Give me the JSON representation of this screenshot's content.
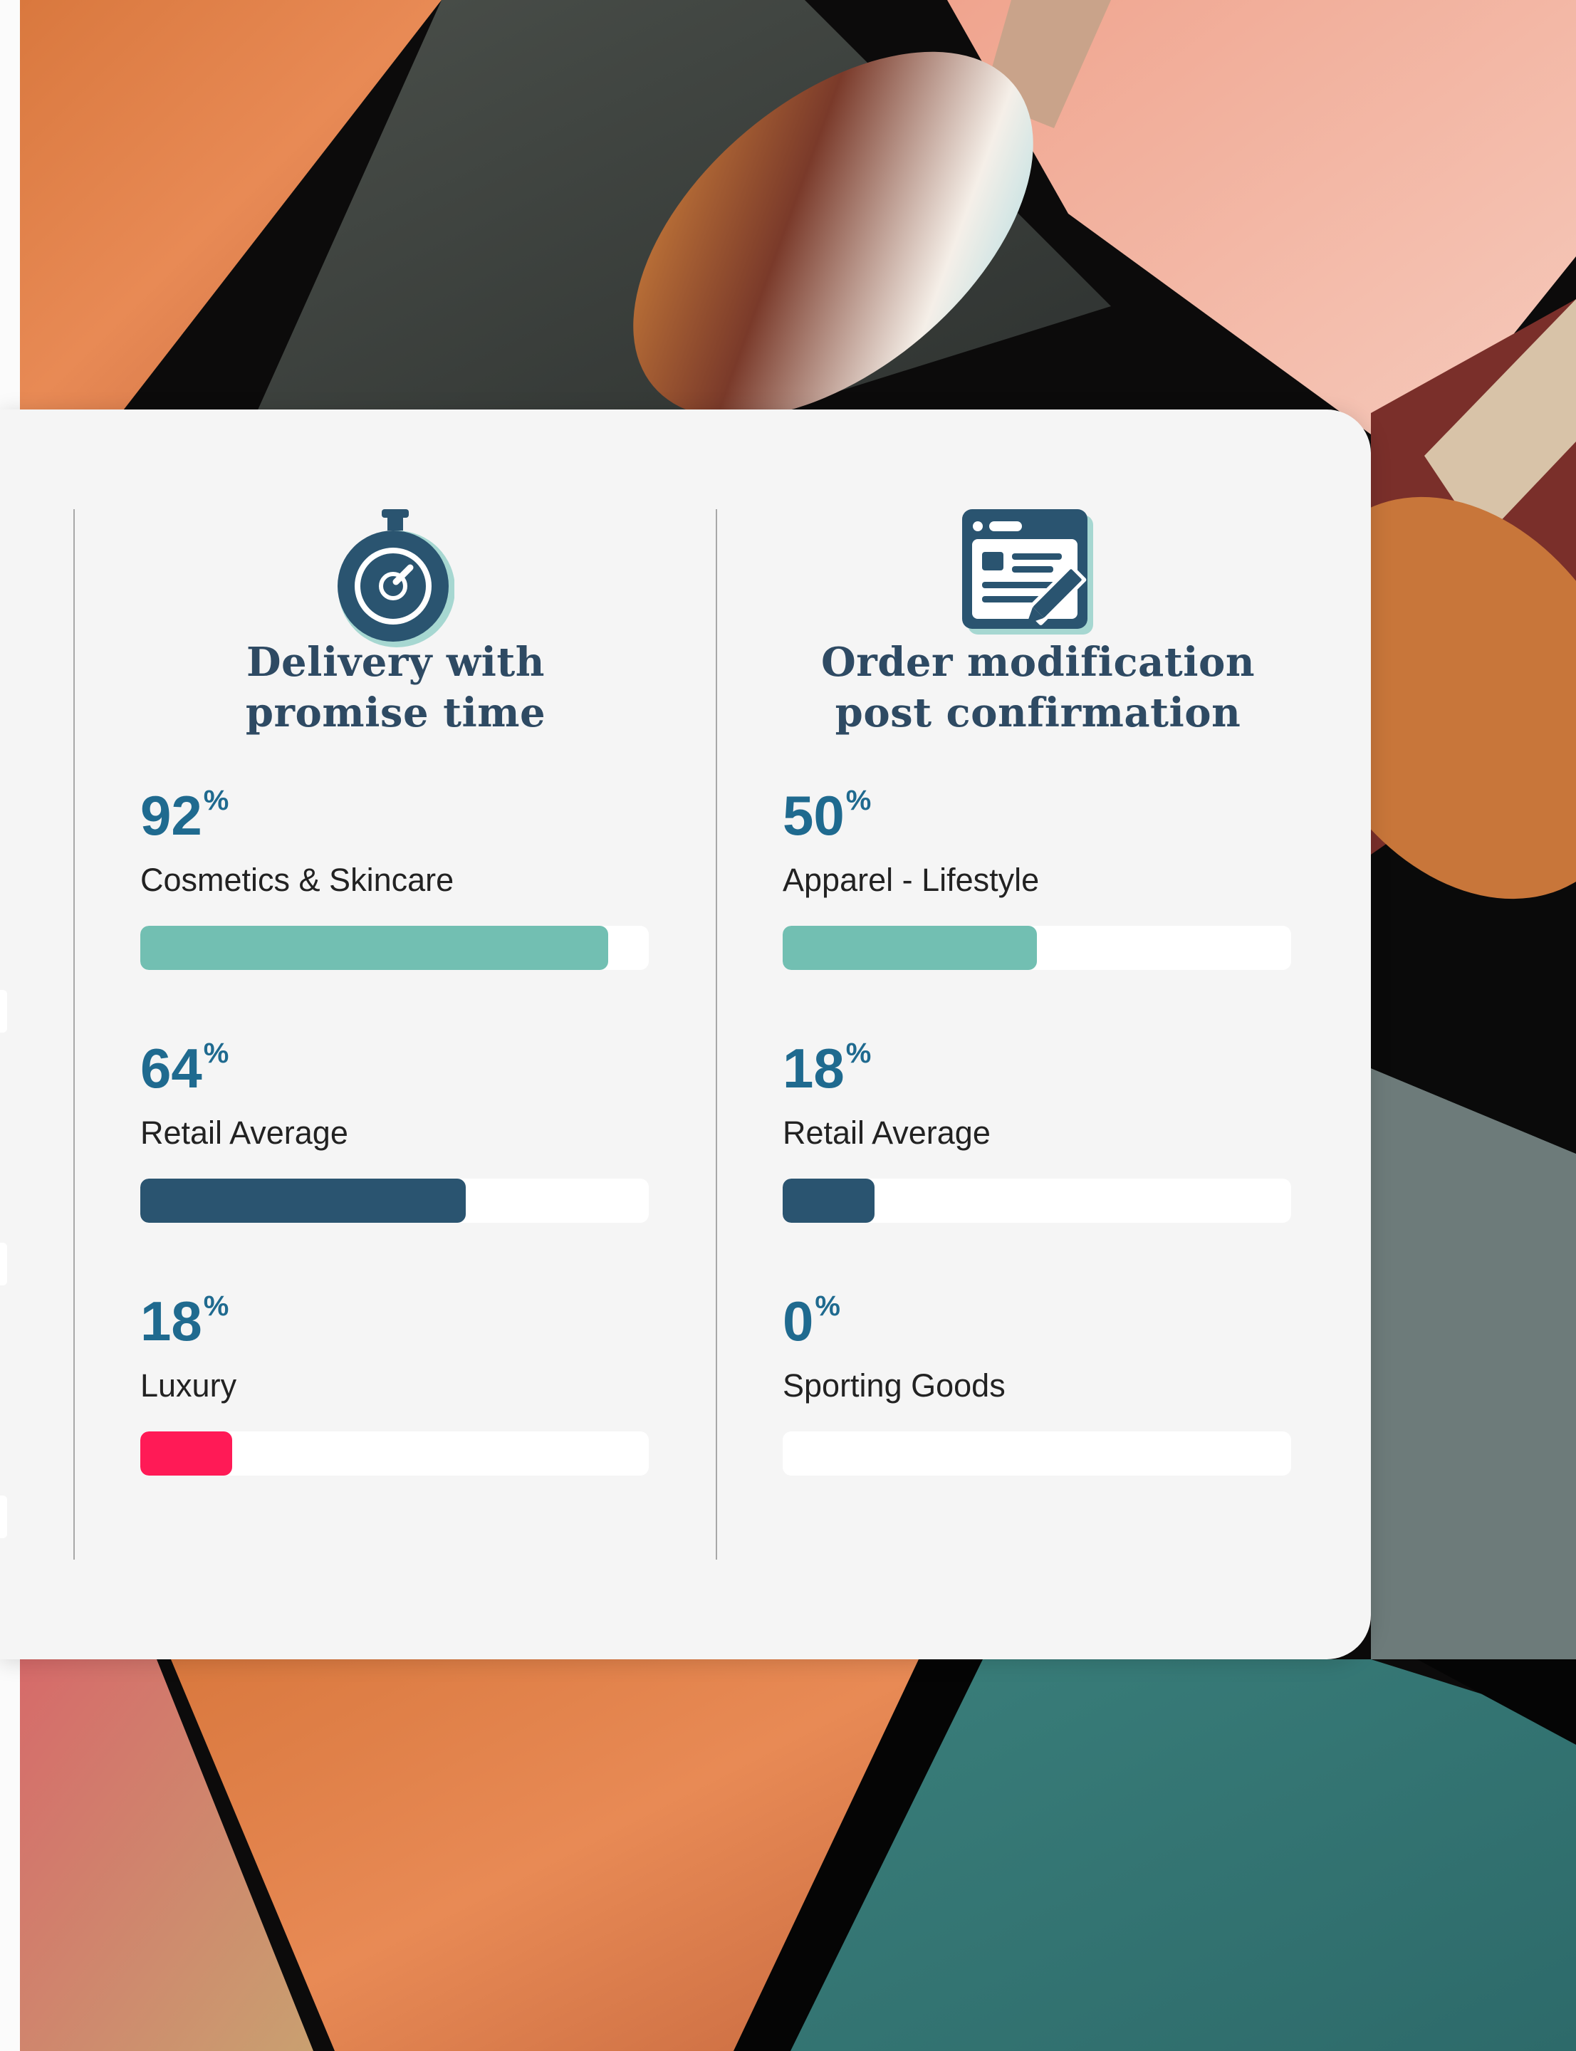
{
  "columns": [
    {
      "icon": "stopwatch-icon",
      "title_line1": "Delivery with",
      "title_line2": "promise time",
      "metrics": [
        {
          "value": "92",
          "unit": "%",
          "label": "Cosmetics & Skincare",
          "fraction": 0.92,
          "color": "#72bfb2"
        },
        {
          "value": "64",
          "unit": "%",
          "label": "Retail Average",
          "fraction": 0.64,
          "color": "#2a5470"
        },
        {
          "value": "18",
          "unit": "%",
          "label": "Luxury",
          "fraction": 0.18,
          "color": "#ff1a56"
        }
      ]
    },
    {
      "icon": "browser-edit-icon",
      "title_line1": "Order modification",
      "title_line2": "post confirmation",
      "metrics": [
        {
          "value": "50",
          "unit": "%",
          "label": "Apparel - Lifestyle",
          "fraction": 0.5,
          "color": "#72bfb2"
        },
        {
          "value": "18",
          "unit": "%",
          "label": "Retail Average",
          "fraction": 0.18,
          "color": "#2a5470"
        },
        {
          "value": "0",
          "unit": "%",
          "label": "Sporting Goods",
          "fraction": 0.0,
          "color": "#2a5470"
        }
      ]
    }
  ],
  "colors": {
    "card_background": "#f5f5f5",
    "title": "#2e4a63",
    "value": "#1f6a8f",
    "track": "#ffffff",
    "divider": "#a8a8a8",
    "icon": "#2a5470"
  }
}
